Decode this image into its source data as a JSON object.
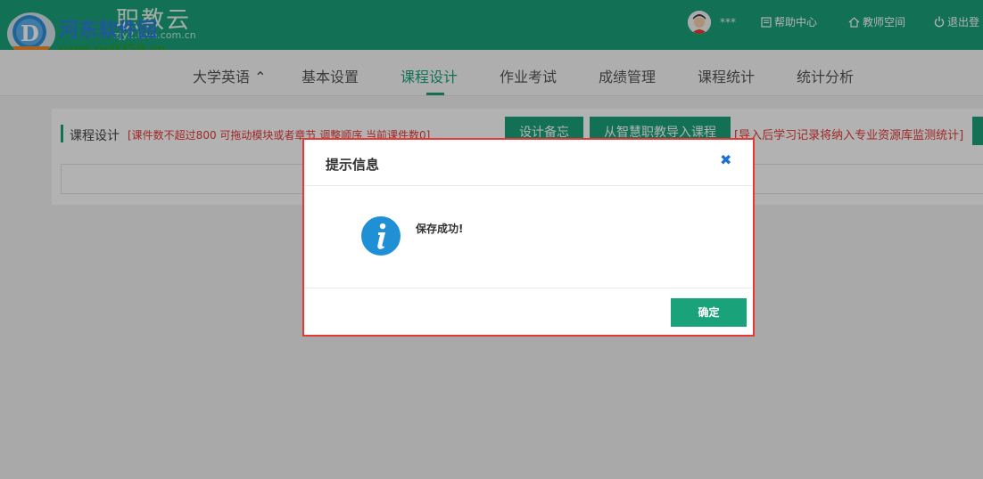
{
  "header": {
    "logo_title": "职教云",
    "logo_subtitle": "zjy2.icve.com.cn",
    "watermark_text": "河东软件园",
    "watermark_url": "www.pc0359.cn",
    "user_name": "***",
    "help_label": "帮助中心",
    "teacher_space_label": "教师空间",
    "logout_label": "退出登"
  },
  "nav": {
    "items": [
      {
        "label": "大学英语 ⌃"
      },
      {
        "label": "基本设置"
      },
      {
        "label": "课程设计"
      },
      {
        "label": "作业考试"
      },
      {
        "label": "成绩管理"
      },
      {
        "label": "课程统计"
      },
      {
        "label": "统计分析"
      }
    ],
    "active": "课程设计"
  },
  "content": {
    "section_title": "课程设计",
    "hint": "[课件数不超过800 可拖动模块或者章节 调整顺序 当前课件数0]",
    "backup_button": "设计备忘",
    "import_button": "从智慧职教导入课程",
    "import_hint": "[导入后学习记录将纳入专业资源库监测统计]"
  },
  "dialog": {
    "title": "提示信息",
    "message": "保存成功!",
    "ok_label": "确定"
  },
  "colors": {
    "brand": "#1aa37a",
    "warning_text": "#e53935",
    "dialog_border": "#e53935",
    "info_icon": "#1f8fd6"
  }
}
